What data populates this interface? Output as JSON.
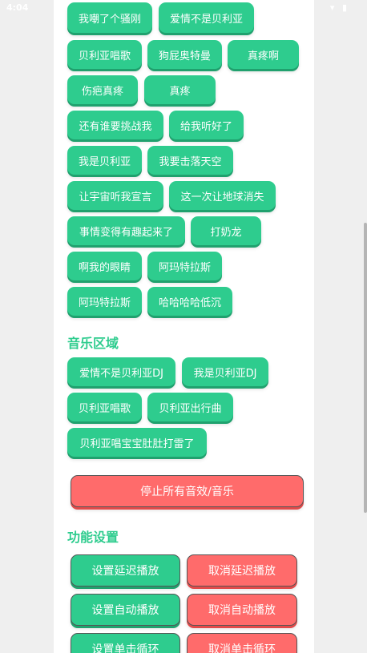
{
  "status": {
    "time": "4:04",
    "icons": "▾ ▮"
  },
  "sound_buttons": [
    "我嘲了个骚刚",
    "爱情不是贝利亚",
    "贝利亚唱歌",
    "狗屁奥特曼",
    "真疼啊",
    "伤疤真疼",
    "真疼",
    "还有谁要挑战我",
    "给我听好了",
    "我是贝利亚",
    "我要击落天空",
    "让宇宙听我宣言",
    "这一次让地球消失",
    "事情变得有趣起来了",
    "打奶龙",
    "啊我的眼睛",
    "阿玛特拉斯",
    "阿玛特拉斯",
    "哈哈哈哈低沉"
  ],
  "music_section": {
    "title": "音乐区域",
    "buttons": [
      "爱情不是贝利亚DJ",
      "我是贝利亚DJ",
      "贝利亚唱歌",
      "贝利亚出行曲",
      "贝利亚唱宝宝肚肚打雷了"
    ]
  },
  "stop_all_label": "停止所有音效/音乐",
  "settings_section": {
    "title": "功能设置",
    "set_delay": "设置延迟播放",
    "cancel_delay": "取消延迟播放",
    "set_auto": "设置自动播放",
    "cancel_auto": "取消自动播放",
    "set_loop": "设置单击循环",
    "cancel_loop": "取消单击循环"
  }
}
